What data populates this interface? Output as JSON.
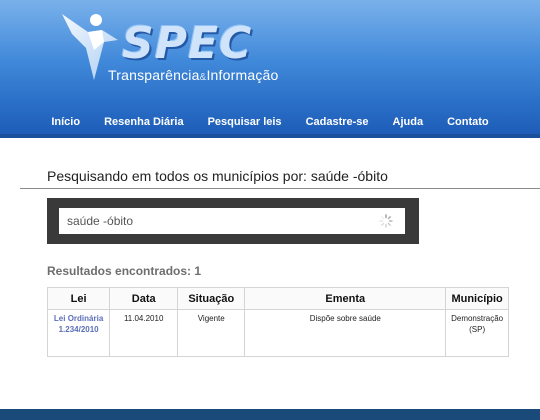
{
  "brand": {
    "name": "SPEC",
    "tagline_part1": "Transparência",
    "tagline_amp": "&",
    "tagline_part2": "Informação"
  },
  "nav": {
    "items": [
      {
        "label": "Início"
      },
      {
        "label": "Resenha Diária"
      },
      {
        "label": "Pesquisar leis"
      },
      {
        "label": "Cadastre-se"
      },
      {
        "label": "Ajuda"
      },
      {
        "label": "Contato"
      }
    ]
  },
  "search": {
    "heading": "Pesquisando em todos os municípios por:",
    "query": "saúde -óbito",
    "input_value": "saúde -óbito"
  },
  "results": {
    "count_text": "Resultados encontrados: 1",
    "columns": [
      "Lei",
      "Data",
      "Situação",
      "Ementa",
      "Município"
    ],
    "rows": [
      {
        "lei_line1": "Lei Ordinária",
        "lei_line2": "1.234/2010",
        "data": "11.04.2010",
        "situacao": "Vigente",
        "ementa": "Dispõe sobre saúde",
        "municipio_line1": "Demonstração",
        "municipio_line2": "(SP)"
      }
    ]
  },
  "colors": {
    "header_blue": "#2a6fc7",
    "status_active": "#23c423",
    "link": "#5b6fb8",
    "search_box_bg": "#3a3a3a"
  }
}
